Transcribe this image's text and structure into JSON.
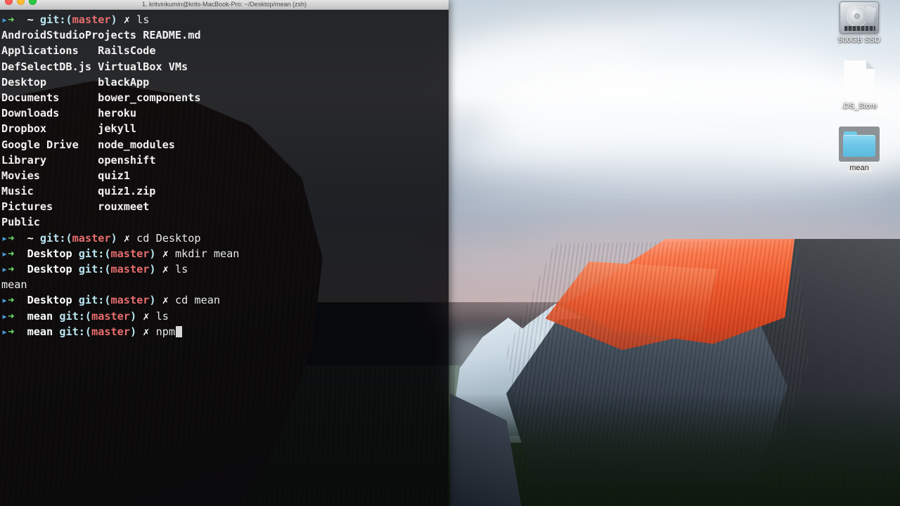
{
  "window": {
    "title": "1. kritvinkumin@krits-MacBook-Pro: ~/Desktop/mean (zsh)",
    "close_label": "close",
    "minimize_label": "minimize",
    "zoom_label": "zoom"
  },
  "terminal": {
    "prompt": {
      "arrow": "↳",
      "git_label": "git:",
      "branch": "master",
      "open_paren": "(",
      "close_paren": ")",
      "status_mark": "✗"
    },
    "lines": [
      {
        "type": "prompt",
        "path": "~",
        "command": "ls"
      },
      {
        "type": "output2",
        "left": "AndroidStudioProjects",
        "right": "README.md"
      },
      {
        "type": "output2",
        "left": "Applications",
        "right": "RailsCode"
      },
      {
        "type": "output2",
        "left": "DefSelectDB.js",
        "right": "VirtualBox VMs"
      },
      {
        "type": "output2",
        "left": "Desktop",
        "right": "blackApp"
      },
      {
        "type": "output2",
        "left": "Documents",
        "right": "bower_components"
      },
      {
        "type": "output2",
        "left": "Downloads",
        "right": "heroku"
      },
      {
        "type": "output2",
        "left": "Dropbox",
        "right": "jekyll"
      },
      {
        "type": "output2",
        "left": "Google Drive",
        "right": "node_modules"
      },
      {
        "type": "output2",
        "left": "Library",
        "right": "openshift"
      },
      {
        "type": "output2",
        "left": "Movies",
        "right": "quiz1"
      },
      {
        "type": "output2",
        "left": "Music",
        "right": "quiz1.zip"
      },
      {
        "type": "output2",
        "left": "Pictures",
        "right": "rouxmeet"
      },
      {
        "type": "output2",
        "left": "Public",
        "right": ""
      },
      {
        "type": "prompt",
        "path": "~",
        "command": "cd Desktop"
      },
      {
        "type": "prompt",
        "path": "Desktop",
        "command": "mkdir mean"
      },
      {
        "type": "prompt",
        "path": "Desktop",
        "command": "ls"
      },
      {
        "type": "output1",
        "left": "mean"
      },
      {
        "type": "prompt",
        "path": "Desktop",
        "command": "cd mean"
      },
      {
        "type": "prompt",
        "path": "mean",
        "command": "ls"
      },
      {
        "type": "prompt",
        "path": "mean",
        "command": "npm",
        "cursor": true
      }
    ]
  },
  "desktop": {
    "icons": [
      {
        "name": "500GB SSD",
        "kind": "hard-drive",
        "selected": false
      },
      {
        "name": ".DS_Store",
        "kind": "document",
        "selected": false
      },
      {
        "name": "mean",
        "kind": "folder",
        "selected": true
      }
    ]
  },
  "colors": {
    "branch": "#e86d6d",
    "prompt_arrow": "#6fe36f",
    "git_label": "#b9e6f0",
    "terminal_bg": "#08080a",
    "folder_blue": "#6ec6e8"
  }
}
